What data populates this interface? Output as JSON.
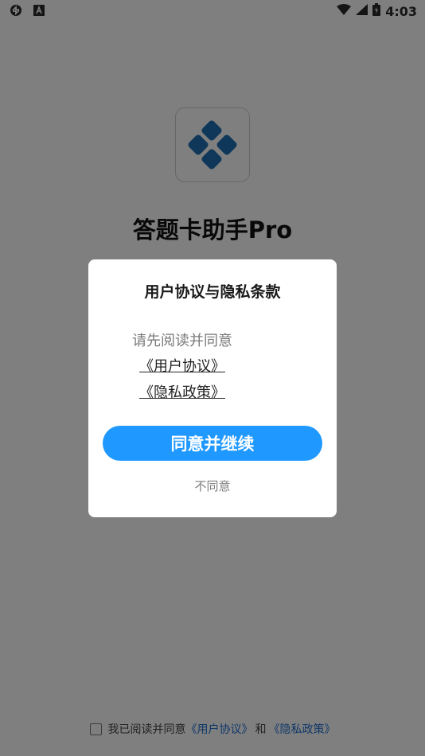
{
  "status_bar": {
    "time": "4:03",
    "icons": [
      "sync-icon",
      "a-icon",
      "wifi-icon",
      "signal-icon",
      "battery-icon"
    ]
  },
  "app": {
    "title": "答题卡助手Pro",
    "logo_color": "#1f6fb3"
  },
  "dialog": {
    "title": "用户协议与隐私条款",
    "intro": "请先阅读并同意",
    "link_user_agreement": "《用户协议》",
    "link_privacy_policy": "《隐私政策》",
    "agree_button": "同意并继续",
    "disagree_button": "不同意",
    "accent_color": "#1f99ff"
  },
  "bottom_agreement": {
    "text": "我已阅读并同意",
    "link_user_agreement": "《用户协议》",
    "connector": "和",
    "link_privacy_policy": "《隐私政策》"
  }
}
